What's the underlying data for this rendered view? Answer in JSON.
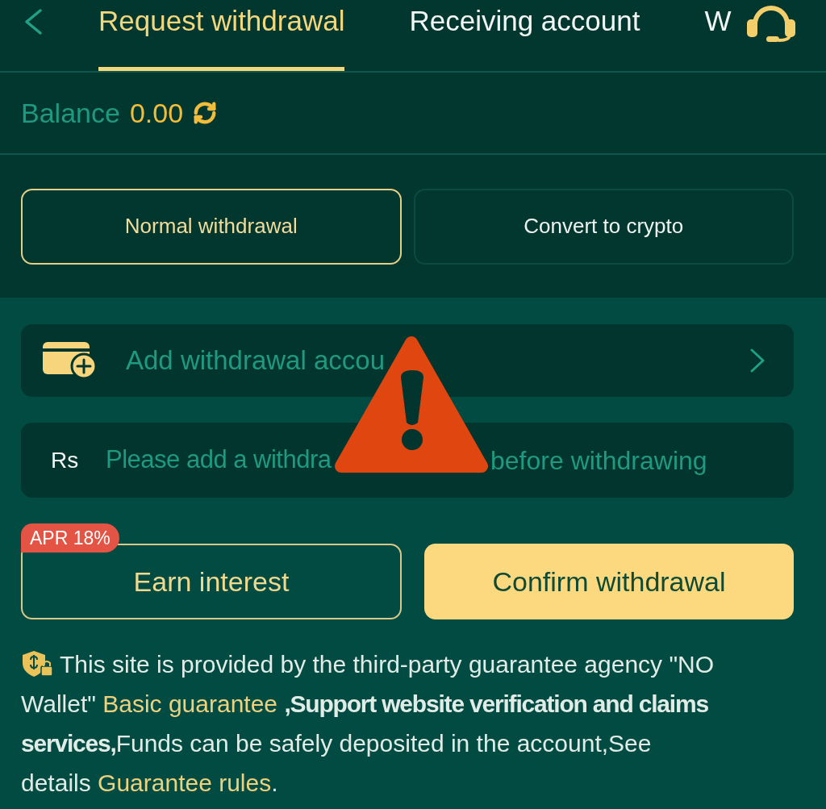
{
  "tabs": [
    {
      "label": "Request withdrawal",
      "selected": true
    },
    {
      "label": "Receiving account",
      "selected": false
    },
    {
      "label": "W",
      "selected": false
    }
  ],
  "balance": {
    "label": "Balance",
    "amount": "0.00"
  },
  "withdrawal_modes": [
    {
      "label": "Normal withdrawal",
      "selected": true
    },
    {
      "label": "Convert to crypto",
      "selected": false
    }
  ],
  "add_account": {
    "label": "Add withdrawal accou"
  },
  "amount_field": {
    "currency": "Rs",
    "placeholder": [
      "Please add a withdra",
      "before withdrawing"
    ]
  },
  "actions": [
    {
      "kind": "outline",
      "label": "Earn interest",
      "badge": "APR 18%"
    },
    {
      "kind": "primary",
      "label": "Confirm withdrawal"
    }
  ],
  "notice": {
    "parts": [
      {
        "kind": "text",
        "text": "This site is provided by the third-party guarantee agency \"NO Wallet\" "
      },
      {
        "kind": "link",
        "text": "Basic guarantee"
      },
      {
        "kind": "text",
        "text": " **,Support website verification and claims services,**Funds can be safely deposited in the account,See details "
      },
      {
        "kind": "link",
        "text": "Guarantee rules"
      },
      {
        "kind": "text",
        "text": "."
      }
    ]
  }
}
